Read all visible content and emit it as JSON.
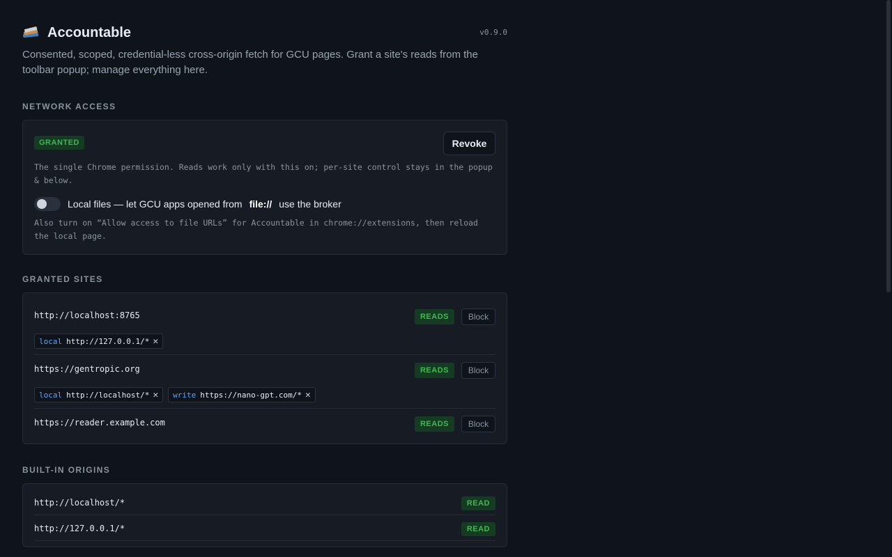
{
  "header": {
    "logo_icon": "books-icon",
    "title": "Accountable",
    "version": "v0.9.0",
    "subtitle": "Consented, scoped, credential-less cross-origin fetch for GCU pages. Grant a site's reads from the toolbar popup; manage everything here."
  },
  "network": {
    "section_title": "NETWORK ACCESS",
    "status_badge": "GRANTED",
    "revoke_label": "Revoke",
    "note1": "The single Chrome permission. Reads work only with this on; per-site control stays in the popup & below.",
    "toggle_on": false,
    "toggle_prefix": "Local files — let GCU apps opened from",
    "toggle_code": "file://",
    "toggle_suffix": "use the broker",
    "note2": "Also turn on “Allow access to file URLs” for Accountable in chrome://extensions, then reload the local page."
  },
  "sites": {
    "section_title": "GRANTED SITES",
    "items": [
      {
        "origin": "http://localhost:8765",
        "badge": "READS",
        "block_label": "Block",
        "chips": [
          {
            "kind": "local",
            "pattern": "http://127.0.0.1/*"
          }
        ]
      },
      {
        "origin": "https://gentropic.org",
        "badge": "READS",
        "block_label": "Block",
        "chips": [
          {
            "kind": "local",
            "pattern": "http://localhost/*"
          },
          {
            "kind": "write",
            "pattern": "https://nano-gpt.com/*"
          }
        ]
      },
      {
        "origin": "https://reader.example.com",
        "badge": "READS",
        "block_label": "Block",
        "chips": []
      }
    ]
  },
  "builtin": {
    "section_title": "BUILT-IN ORIGINS",
    "items": [
      {
        "origin": "http://localhost/*",
        "badge": "READ"
      },
      {
        "origin": "http://127.0.0.1/*",
        "badge": "READ"
      }
    ]
  },
  "colors": {
    "background": "#0f131a",
    "card": "#161b24",
    "accent_green": "#3fb950",
    "accent_blue": "#58a6ff"
  }
}
